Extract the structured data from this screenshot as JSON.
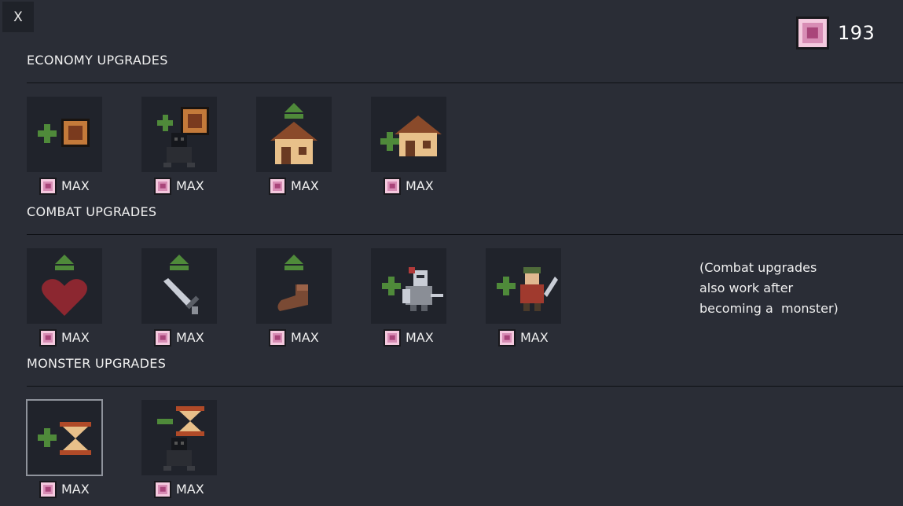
{
  "close_label": "X",
  "currency": {
    "amount": "193",
    "icon": "gem-icon"
  },
  "sections": [
    {
      "title": "ECONOMY UPGRADES",
      "items": [
        {
          "icon": "plus-gem-icon",
          "price": "MAX"
        },
        {
          "icon": "plus-gem-villager-icon",
          "price": "MAX"
        },
        {
          "icon": "upgrade-house-icon",
          "price": "MAX"
        },
        {
          "icon": "plus-house-icon",
          "price": "MAX"
        }
      ]
    },
    {
      "title": "COMBAT UPGRADES",
      "items": [
        {
          "icon": "upgrade-heart-icon",
          "price": "MAX"
        },
        {
          "icon": "upgrade-sword-icon",
          "price": "MAX"
        },
        {
          "icon": "upgrade-boot-icon",
          "price": "MAX"
        },
        {
          "icon": "plus-knight-icon",
          "price": "MAX"
        },
        {
          "icon": "plus-archer-icon",
          "price": "MAX"
        }
      ],
      "note": [
        "(Combat upgrades",
        "also work after",
        "becoming a  monster)"
      ]
    },
    {
      "title": "MONSTER UPGRADES",
      "items": [
        {
          "icon": "plus-hourglass-icon",
          "price": "MAX"
        },
        {
          "icon": "minus-hourglass-monster-icon",
          "price": "MAX"
        }
      ]
    }
  ],
  "colors": {
    "background": "#2a2d36",
    "card": "#20232b",
    "gem": "#d88db5",
    "plus": "#4f8a3a"
  }
}
